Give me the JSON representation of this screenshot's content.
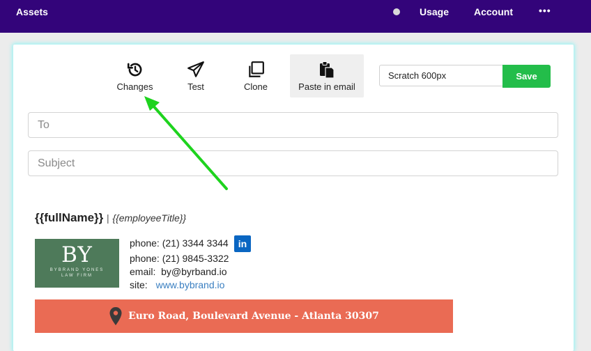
{
  "topbar": {
    "assets": "Assets",
    "usage": "Usage",
    "account": "Account",
    "more": "•••"
  },
  "toolbar": {
    "changes": "Changes",
    "test": "Test",
    "clone": "Clone",
    "paste": "Paste in email",
    "template_value": "Scratch 600px",
    "save": "Save"
  },
  "form": {
    "to_placeholder": "To",
    "subject_placeholder": "Subject"
  },
  "signature": {
    "name": "{{fullName}}",
    "separator": "|",
    "title": "{{employeeTitle}}",
    "logo_big": "BY",
    "logo_small_1": "BYBRAND YONES",
    "logo_small_2": "LAW FIRM",
    "phone1": "phone: (21) 3344 3344",
    "phone2": "phone: (21) 9845-3322",
    "email": "email:  by@byrband.io",
    "site_label": "site:",
    "site_link": "www.bybrand.io",
    "linkedin": "in",
    "address": "Euro Road, Boulevard Avenue - Atlanta 30307"
  },
  "colors": {
    "topbar": "#33047a",
    "save": "#23bd4a",
    "banner": "#ea6b54",
    "arrow": "#1ed31e"
  }
}
